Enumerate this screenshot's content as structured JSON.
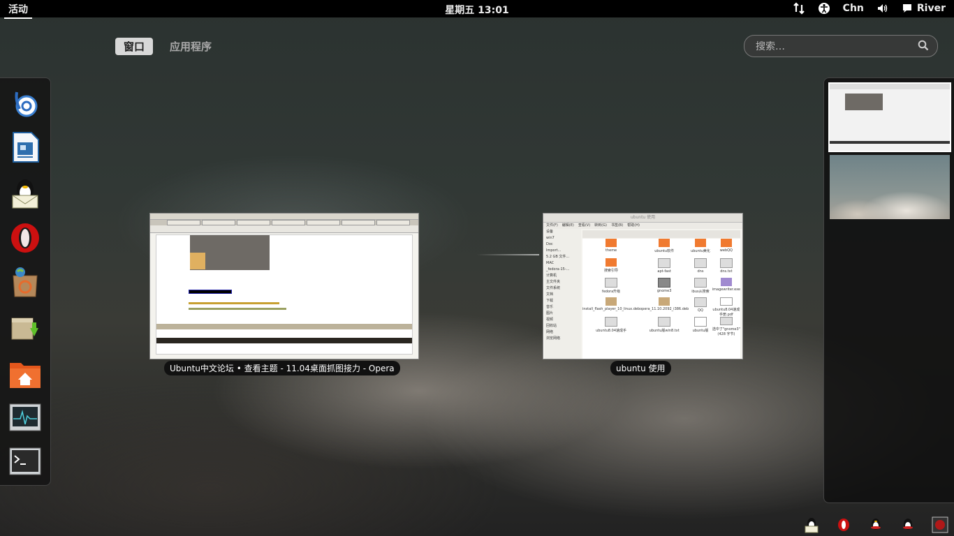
{
  "topbar": {
    "activities": "活动",
    "clock": "星期五 13:01",
    "input_method": "Chn",
    "user": "River"
  },
  "view_selector": {
    "windows": "窗口",
    "applications": "应用程序"
  },
  "search": {
    "placeholder": "搜索…"
  },
  "dash": {
    "items": [
      "banshee-icon",
      "writer-icon",
      "qq-mail-icon",
      "opera-icon",
      "software-center-icon",
      "archive-install-icon",
      "home-folder-icon",
      "system-monitor-icon",
      "terminal-icon"
    ]
  },
  "windows": [
    {
      "title": "Ubuntu中文论坛 • 查看主题 - 11.04桌面抓图接力 - Opera"
    },
    {
      "title": "ubuntu 使用"
    }
  ],
  "nautilus": {
    "window_title": "ubuntu 使用",
    "menu": [
      "文件(F)",
      "编辑(E)",
      "查看(V)",
      "转到(G)",
      "书签(B)",
      "帮助(H)"
    ],
    "sidebar": [
      "设备",
      "win7",
      "Doc",
      "Import...",
      "5.2 GB 文件...",
      "MAC",
      "_fedora-15-...",
      "计算机",
      "主文件夹",
      "文件系统",
      "文档",
      "下载",
      "音乐",
      "图片",
      "视频",
      "回收站",
      "网络",
      "浏览网络"
    ],
    "files": [
      "theme",
      "ubuntu软件",
      "ubuntu美化",
      "webQQ",
      "搜索引导",
      "apt-fast",
      "dns",
      "dns.txt",
      "fedora升级",
      "gnome3",
      "ibus从搜索",
      "imagewriter.exe",
      "install_flash_player_10_linux.deb",
      "opera_11.10.2092_i386.deb",
      "QQ",
      "ubuntu8.04速成手册.pdf",
      "ubuntu8.04速成手",
      "ubuntu版win8.txt",
      "ubuntu版",
      "选中了\"gnome3\" (428 字节)"
    ]
  },
  "colors": {
    "topbar": "#000000",
    "active_tab": "#d8d8d8",
    "opera_red": "#cc1010"
  }
}
